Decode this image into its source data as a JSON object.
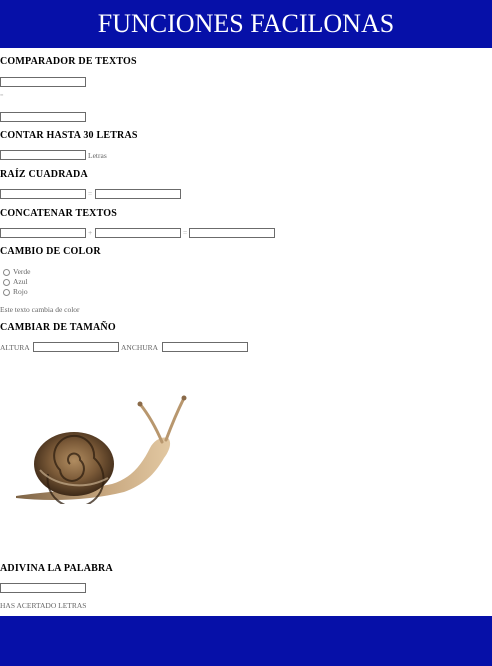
{
  "header": {
    "title": "FUNCIONES FACILONAS"
  },
  "comparador": {
    "heading": "COMPARADOR DE TEXTOS",
    "separator": "="
  },
  "contar": {
    "heading": "CONTAR HASTA 30 LETRAS",
    "suffix": "Letras"
  },
  "raiz": {
    "heading": "RAÍZ CUADRADA",
    "equals": "="
  },
  "concatenar": {
    "heading": "CONCATENAR TEXTOS",
    "plus": "+",
    "equals": "="
  },
  "color": {
    "heading": "CAMBIO DE COLOR",
    "options": [
      "Verde",
      "Azul",
      "Rojo"
    ],
    "sample_text": "Este texto cambia de color"
  },
  "tamano": {
    "heading": "CAMBIAR DE TAMAÑO",
    "height_label": "ALTURA",
    "width_label": "ANCHURA"
  },
  "adivina": {
    "heading": "ADIVINA LA PALABRA",
    "result": "HAS ACERTADO LETRAS"
  },
  "colors": {
    "header_bg": "#0610a8",
    "footer_bg": "#0610a8"
  },
  "image": {
    "icon": "snail-image"
  }
}
